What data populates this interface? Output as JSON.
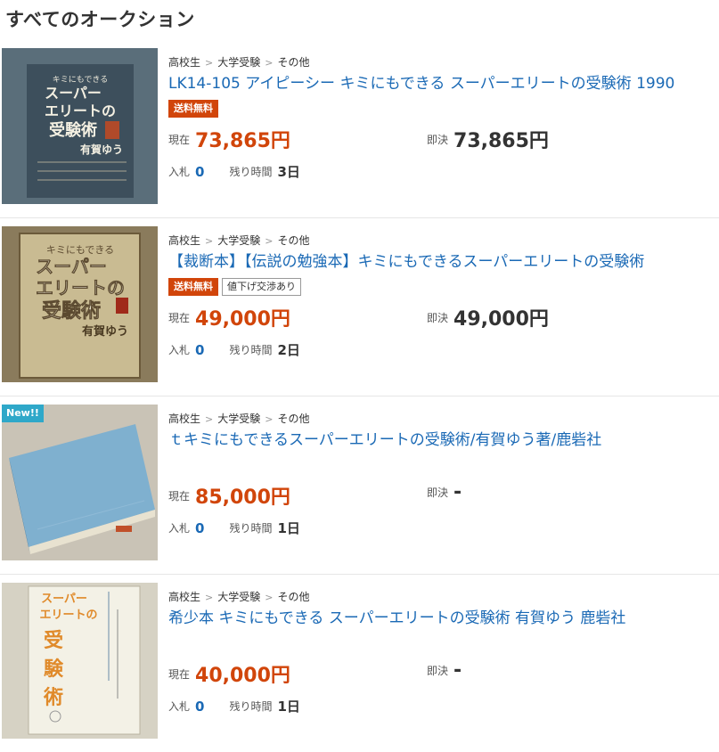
{
  "page": {
    "title": "すべてのオークション"
  },
  "items": [
    {
      "new_label": "",
      "breadcrumb": [
        "高校生",
        "大学受験",
        "その他"
      ],
      "title": "LK14-105 アイピーシー キミにもできる スーパーエリートの受験術 1990",
      "badges": {
        "shipping": "送料無料",
        "negotiable": ""
      },
      "current_label": "現在",
      "current_price": "73,865円",
      "buynow_label": "即決",
      "buynow_price": "73,865円",
      "bids_label": "入札",
      "bids": "0",
      "time_label": "残り時間",
      "time_left": "3日",
      "cover": {
        "bg": "#40535f",
        "lines": [
          "キミにもできる",
          "スーパー",
          "エリートの",
          "受験術",
          "有賀ゆう"
        ]
      }
    },
    {
      "new_label": "",
      "breadcrumb": [
        "高校生",
        "大学受験",
        "その他"
      ],
      "title": "【裁断本】【伝説の勉強本】キミにもできるスーパーエリートの受験術",
      "badges": {
        "shipping": "送料無料",
        "negotiable": "値下げ交渉あり"
      },
      "current_label": "現在",
      "current_price": "49,000円",
      "buynow_label": "即決",
      "buynow_price": "49,000円",
      "bids_label": "入札",
      "bids": "0",
      "time_label": "残り時間",
      "time_left": "2日",
      "cover": {
        "bg": "#7a6a4a",
        "lines": [
          "キミにもできる",
          "スーパー",
          "エリートの",
          "受験術",
          "有賀ゆう"
        ]
      }
    },
    {
      "new_label": "New!!",
      "breadcrumb": [
        "高校生",
        "大学受験",
        "その他"
      ],
      "title": "ｔキミにもできるスーパーエリートの受験術/有賀ゆう著/鹿砦社",
      "badges": {
        "shipping": "",
        "negotiable": ""
      },
      "current_label": "現在",
      "current_price": "85,000円",
      "buynow_label": "即決",
      "buynow_price": "-",
      "bids_label": "入札",
      "bids": "0",
      "time_label": "残り時間",
      "time_left": "1日",
      "cover": {
        "bg": "#6f9fbf",
        "lines": []
      }
    },
    {
      "new_label": "",
      "breadcrumb": [
        "高校生",
        "大学受験",
        "その他"
      ],
      "title": "希少本 キミにもできる スーパーエリートの受験術 有賀ゆう 鹿砦社",
      "badges": {
        "shipping": "",
        "negotiable": ""
      },
      "current_label": "現在",
      "current_price": "40,000円",
      "buynow_label": "即決",
      "buynow_price": "-",
      "bids_label": "入札",
      "bids": "0",
      "time_label": "残り時間",
      "time_left": "1日",
      "cover": {
        "bg": "#e8e4d0",
        "lines": [
          "スーパー",
          "エリートの",
          "受",
          "験",
          "術"
        ]
      }
    }
  ]
}
